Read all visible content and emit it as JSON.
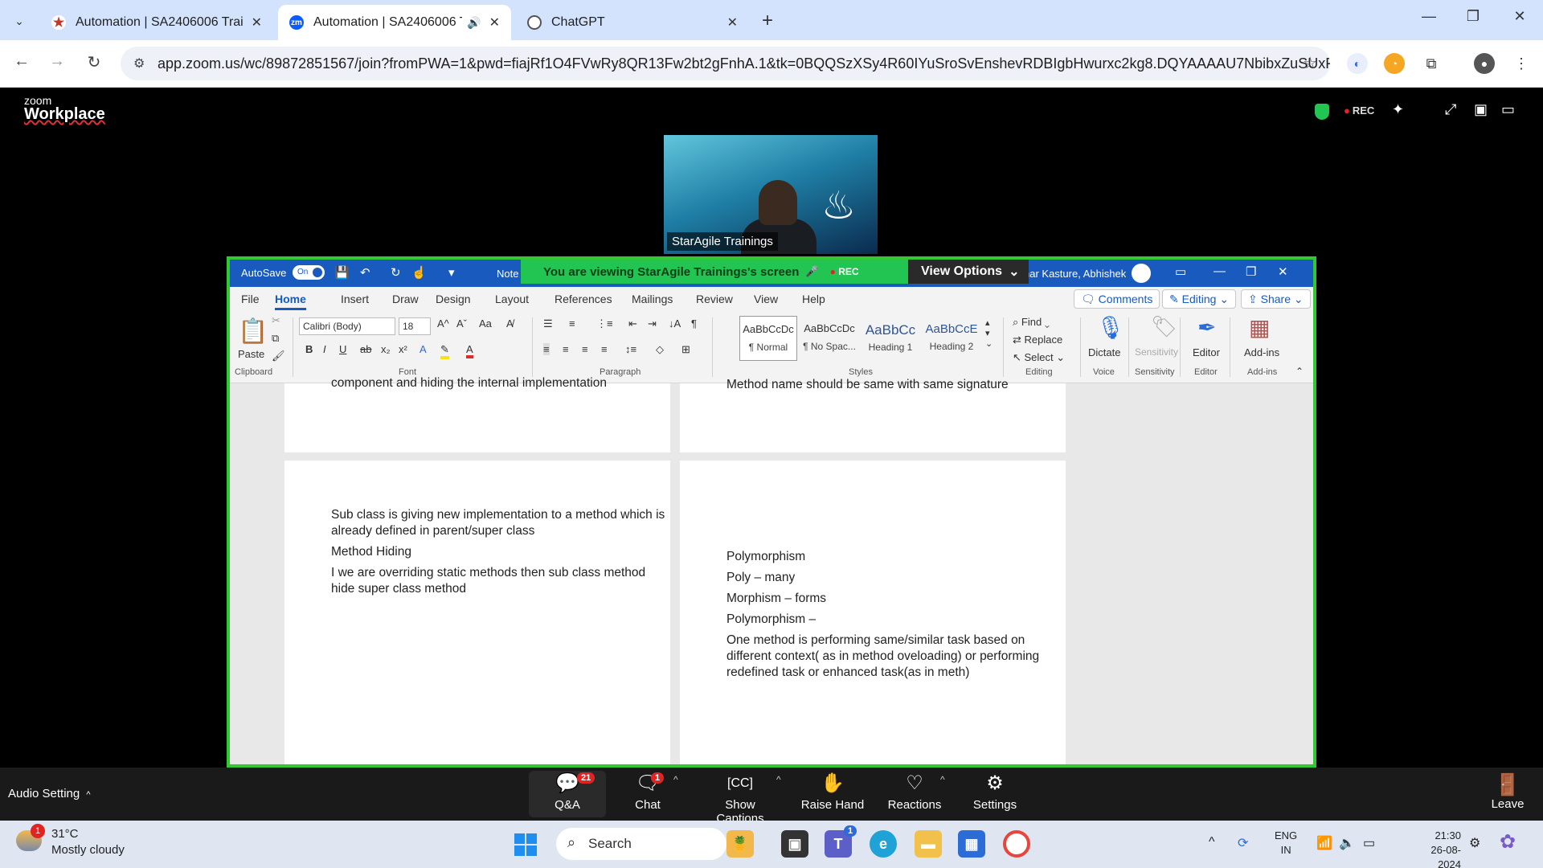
{
  "browser": {
    "tabs": [
      {
        "title": "Automation | SA2406006 Traini",
        "favicon_color": "#c0392b"
      },
      {
        "title": "Automation | SA2406006 Tr",
        "favicon_color": "#0b5cff",
        "favicon_text": "zm"
      },
      {
        "title": "ChatGPT",
        "favicon_color": "#555555"
      }
    ],
    "url": "app.zoom.us/wc/89872851567/join?fromPWA=1&pwd=fiajRf1O4FVwRy8QR13Fw2bt2gFnhA.1&tk=0BQQSzXSy4R60IYuSroSvEnshevRDBIgbHwurxc2kg8.DQYAAAAU7NbibxZuSUxFZ..."
  },
  "zoom": {
    "logo_small": "zoom",
    "logo_big": "Workplace",
    "rec": "REC",
    "participant_name": "StarAgile Trainings",
    "viewing_banner": "You are viewing  StarAgile Trainings's screen",
    "banner_rec": "REC",
    "view_options": "View Options",
    "audio_setting": "Audio Setting",
    "toolbar": [
      {
        "label": "Q&A",
        "icon": "qa-icon",
        "badge": "21"
      },
      {
        "label": "Chat",
        "icon": "chat-icon",
        "badge": "1"
      },
      {
        "label": "Show Captions",
        "icon": "cc-icon"
      },
      {
        "label": "Raise Hand",
        "icon": "hand-icon"
      },
      {
        "label": "Reactions",
        "icon": "heart-icon"
      },
      {
        "label": "Settings",
        "icon": "gear-icon"
      }
    ],
    "leave": "Leave"
  },
  "word": {
    "autosave": "AutoSave",
    "toggle": "On",
    "doc_title": "Note",
    "user": "nar Kasture, Abhishek",
    "menu": [
      "File",
      "Home",
      "Insert",
      "Draw",
      "Design",
      "Layout",
      "References",
      "Mailings",
      "Review",
      "View",
      "Help"
    ],
    "comments": "Comments",
    "editing": "Editing",
    "share": "Share",
    "font": "Calibri (Body)",
    "size": "18",
    "paste": "Paste",
    "styles": [
      {
        "sample": "AaBbCcDc",
        "name": "¶ Normal"
      },
      {
        "sample": "AaBbCcDc",
        "name": "¶ No Spac..."
      },
      {
        "sample": "AaBbCc",
        "name": "Heading 1"
      },
      {
        "sample": "AaBbCcE",
        "name": "Heading 2"
      }
    ],
    "editing_group": {
      "find": "Find",
      "replace": "Replace",
      "select": "Select"
    },
    "dictate": "Dictate",
    "sensitivity": "Sensitivity",
    "editor": "Editor",
    "addins": "Add-ins",
    "groups": [
      "Clipboard",
      "Font",
      "Paragraph",
      "Styles",
      "Editing",
      "Voice",
      "Sensitivity",
      "Editor",
      "Add-ins"
    ]
  },
  "document": {
    "top_left_partial": "component and hiding the internal implementation",
    "top_right_partial": "Method name should be same with same signature",
    "left_p1_line1": "Sub class is giving new implementation to a method which is",
    "left_p1_line2": "already defined in parent/super class",
    "left_p2": "Method Hiding",
    "left_p3_line1": "I we are overriding static methods then sub class method",
    "left_p3_line2": "hide super class method",
    "right_lines": [
      "Polymorphism",
      "Poly – many",
      "Morphism – forms",
      "Polymorphism –"
    ],
    "right_p_line1": "One method is performing same/similar task based on",
    "right_p_line2": "different context( as in method oveloading) or performing",
    "right_p_line3": "redefined task or enhanced task(as in meth)"
  },
  "taskbar": {
    "weather_temp": "31°C",
    "weather_desc": "Mostly cloudy",
    "weather_badge": "1",
    "search": "Search",
    "teams_badge": "1",
    "lang1": "ENG",
    "lang2": "IN",
    "time": "21:30",
    "date": "26-08-2024"
  }
}
